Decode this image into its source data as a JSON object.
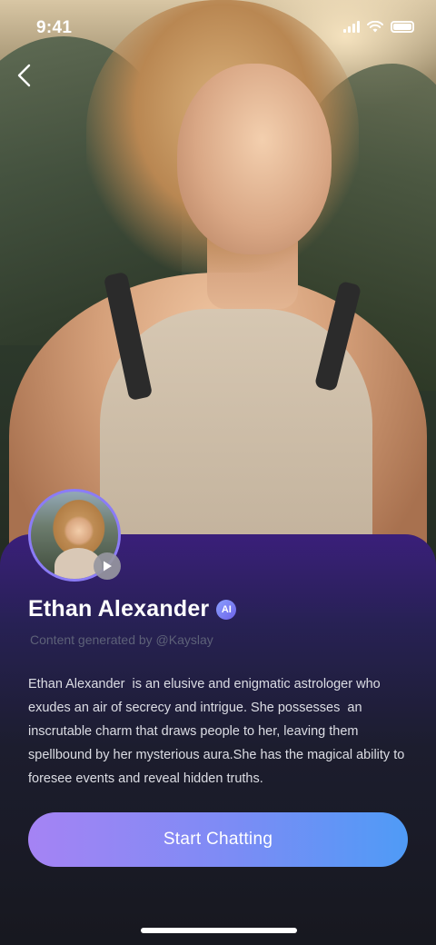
{
  "status_bar": {
    "time": "9:41"
  },
  "profile": {
    "name": "Ethan Alexander",
    "badge": "AI",
    "credit": "Content generated by @Kayslay",
    "bio": "Ethan Alexander  is an elusive and enigmatic astrologer who exudes an air of secrecy and intrigue. She possesses  an inscrutable charm that draws people to her, leaving them spellbound by her mysterious aura.She has the magical ability to foresee events and reveal hidden truths."
  },
  "actions": {
    "start_chatting": "Start Chatting"
  },
  "icons": {
    "back": "chevron-left-icon",
    "play": "play-icon",
    "signal": "signal-icon",
    "wifi": "wifi-icon",
    "battery": "battery-icon"
  },
  "colors": {
    "card_top": "#3a1f7a",
    "card_bottom": "#17181f",
    "button_start": "#a583f4",
    "button_end": "#4f9bf6",
    "avatar_ring": "#8b7cf6"
  }
}
